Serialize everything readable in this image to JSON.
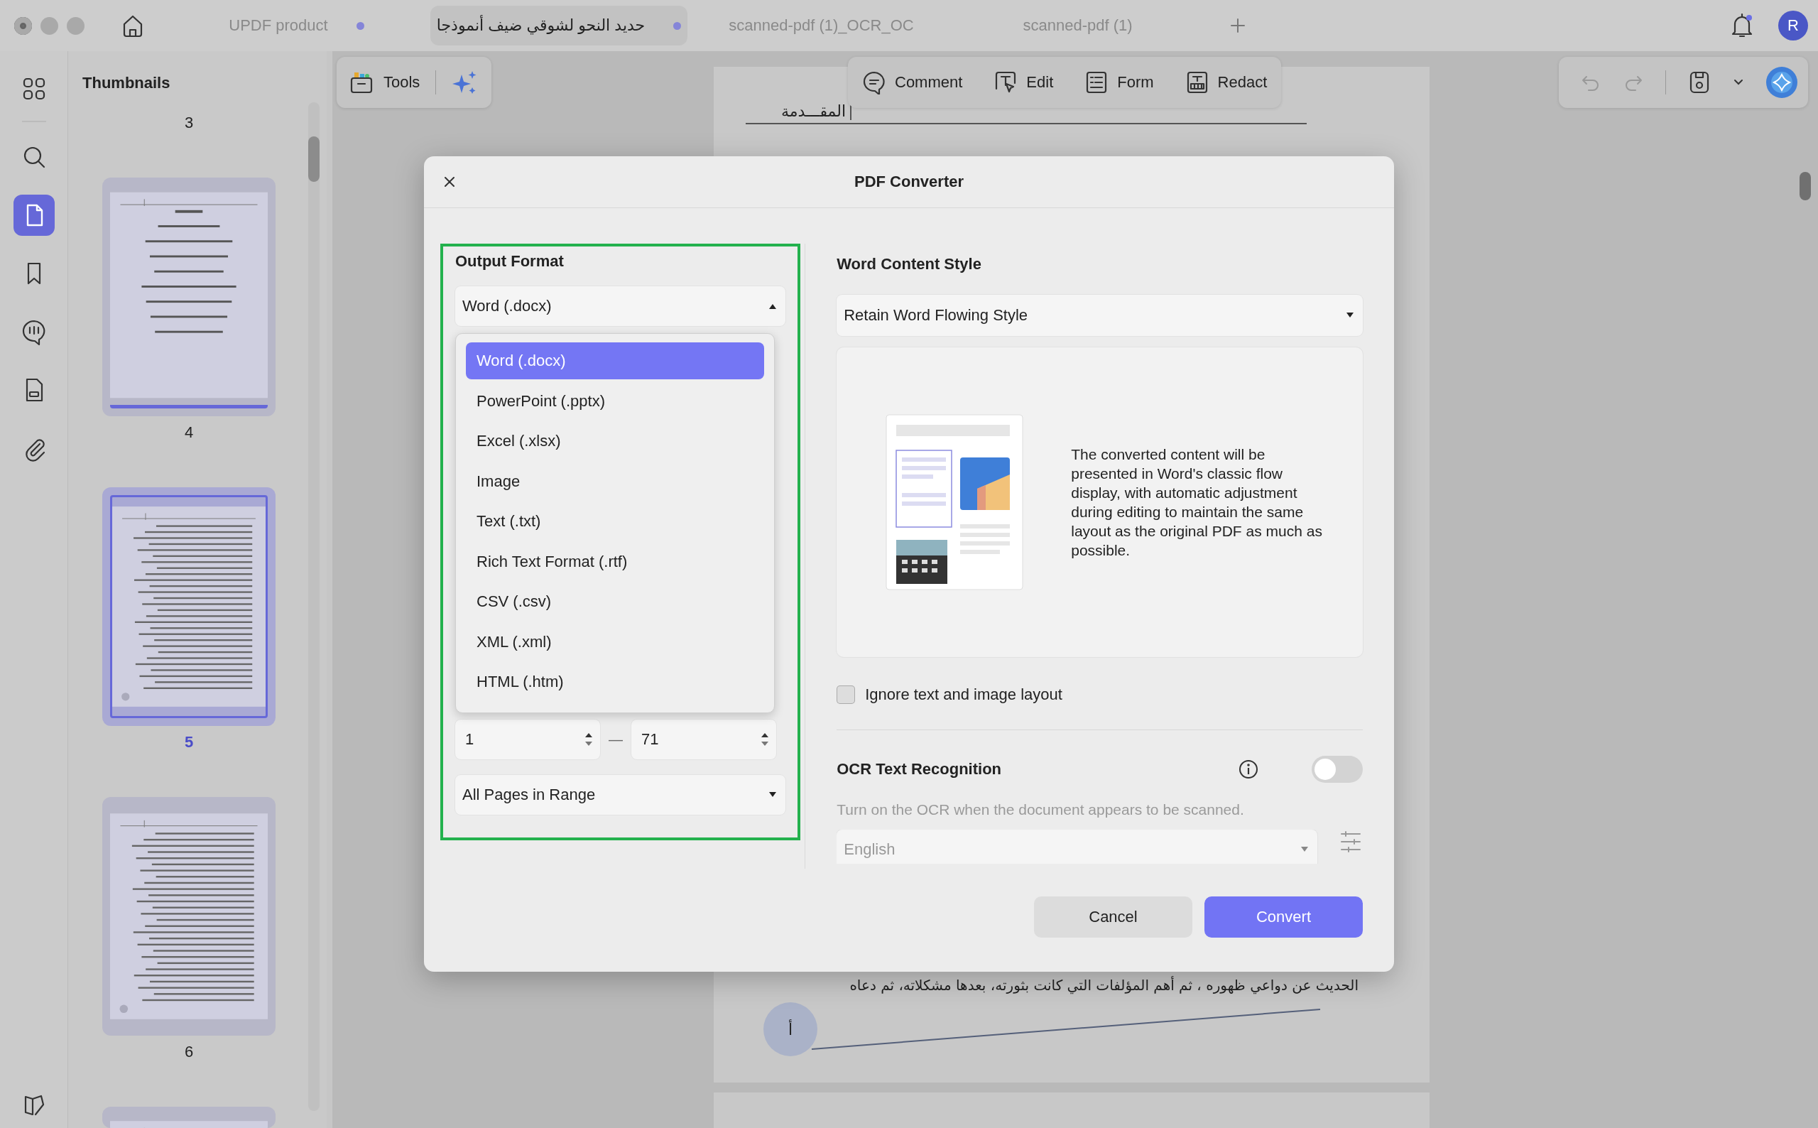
{
  "tabs": [
    {
      "label": "UPDF product",
      "selected": false,
      "modified": true
    },
    {
      "label": "حديد النحو لشوقي ضيف أنموذجا",
      "selected": true,
      "modified": true
    },
    {
      "label": "scanned-pdf (1)_OCR_OC",
      "selected": false,
      "modified": false
    },
    {
      "label": "scanned-pdf (1)",
      "selected": false,
      "modified": false
    }
  ],
  "avatar": "R",
  "rail": [
    {
      "kind": "grid",
      "selected": false
    },
    {
      "kind": "search",
      "selected": false
    },
    {
      "kind": "pages",
      "selected": true
    },
    {
      "kind": "bookmark",
      "selected": false
    },
    {
      "kind": "comment",
      "selected": false
    },
    {
      "kind": "form",
      "selected": false
    },
    {
      "kind": "attachment",
      "selected": false
    }
  ],
  "thumbnails": {
    "title": "Thumbnails",
    "pages": [
      {
        "kind": "label-only",
        "label": "3",
        "selected": false
      },
      {
        "kind": "centered",
        "label": "4",
        "selected": false
      },
      {
        "kind": "dense",
        "label": "5",
        "selected": true
      },
      {
        "kind": "dense",
        "label": "6",
        "selected": false
      },
      {
        "kind": "partial",
        "selected": false
      }
    ]
  },
  "toolbar": {
    "tools": "Tools",
    "modes": [
      {
        "kind": "comment",
        "label": "Comment"
      },
      {
        "kind": "edit",
        "label": "Edit"
      },
      {
        "kind": "form",
        "label": "Form"
      },
      {
        "kind": "redact",
        "label": "Redact"
      }
    ]
  },
  "document": {
    "heading": "المقـــدمة",
    "line": "الحديث عن دواعي ظهوره ، ثم أهم المؤلفات التي كانت بثورته، بعدها مشكلاته، ثم دعاه",
    "page_marker": "أ"
  },
  "dialog": {
    "title": "PDF Converter",
    "output_format": {
      "label": "Output Format",
      "value": "Word (.docx)",
      "expanded": true,
      "options": [
        {
          "label": "Word (.docx)",
          "selected": true
        },
        {
          "label": "PowerPoint (.pptx)",
          "selected": false
        },
        {
          "label": "Excel (.xlsx)",
          "selected": false
        },
        {
          "label": "Image",
          "selected": false
        },
        {
          "label": "Text (.txt)",
          "selected": false
        },
        {
          "label": "Rich Text Format (.rtf)",
          "selected": false
        },
        {
          "label": "CSV (.csv)",
          "selected": false
        },
        {
          "label": "XML (.xml)",
          "selected": false
        },
        {
          "label": "HTML (.htm)",
          "selected": false
        }
      ],
      "range_from": "1",
      "range_separator": "—",
      "range_to": "71",
      "page_subset": "All Pages in Range"
    },
    "word_style": {
      "label": "Word Content Style",
      "value": "Retain Word Flowing Style",
      "description": "The converted content will be presented in Word's classic flow display, with automatic adjustment during editing to maintain the same layout as the original PDF as much as possible."
    },
    "ignore_layout": {
      "label": "Ignore text and image layout",
      "checked": false
    },
    "ocr": {
      "label": "OCR Text Recognition",
      "on": false,
      "hint": "Turn on the OCR when the document appears to be scanned.",
      "language": "English",
      "disabled": true
    },
    "buttons": [
      {
        "kind": "secondary",
        "label": "Cancel"
      },
      {
        "kind": "primary",
        "label": "Convert"
      }
    ]
  }
}
